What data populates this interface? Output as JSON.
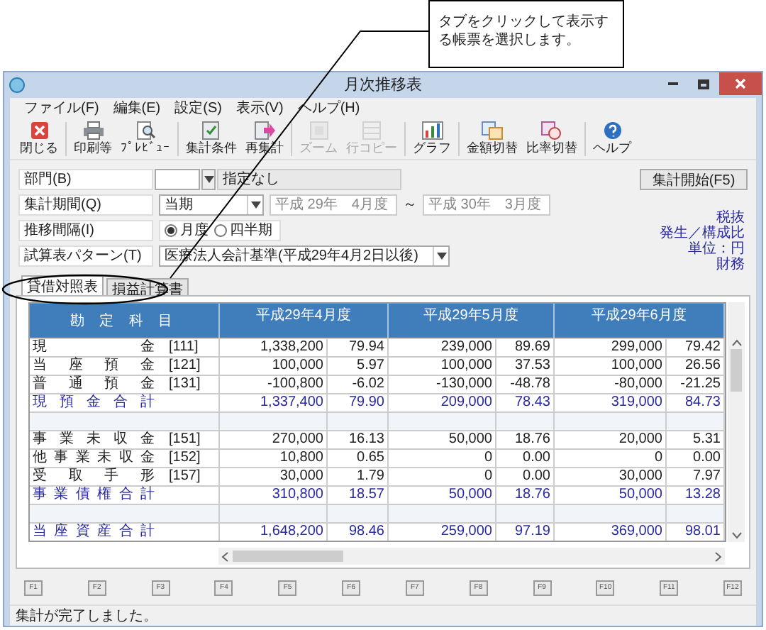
{
  "callout": {
    "text": "タブをクリックして表示する帳票を選択します。"
  },
  "window": {
    "title": "月次推移表"
  },
  "menu": [
    "ファイル(F)",
    "編集(E)",
    "設定(S)",
    "表示(V)",
    "ヘルプ(H)"
  ],
  "toolbar": [
    {
      "label": "閉じる",
      "kind": "close",
      "disabled": false,
      "separator_after": true
    },
    {
      "label": "印刷等",
      "kind": "print",
      "disabled": false,
      "separator_after": false
    },
    {
      "label": "ﾌﾟﾚﾋﾞｭｰ",
      "kind": "preview",
      "disabled": false,
      "separator_after": true
    },
    {
      "label": "集計条件",
      "kind": "conditions",
      "disabled": false,
      "separator_after": false
    },
    {
      "label": "再集計",
      "kind": "recalc",
      "disabled": false,
      "separator_after": true
    },
    {
      "label": "ズーム",
      "kind": "zoom",
      "disabled": true,
      "separator_after": false
    },
    {
      "label": "行コピー",
      "kind": "copy",
      "disabled": true,
      "separator_after": true
    },
    {
      "label": "グラフ",
      "kind": "graph",
      "disabled": false,
      "separator_after": true
    },
    {
      "label": "金額切替",
      "kind": "amount",
      "disabled": false,
      "separator_after": false
    },
    {
      "label": "比率切替",
      "kind": "ratio",
      "disabled": false,
      "separator_after": true
    },
    {
      "label": "ヘルプ",
      "kind": "help",
      "disabled": false,
      "separator_after": false
    }
  ],
  "form": {
    "department": {
      "label": "部門(B)",
      "value": "指定なし"
    },
    "period": {
      "label": "集計期間(Q)",
      "value": "当期",
      "from": "平成 29年　4月度",
      "separator": "～",
      "to": "平成 30年　3月度"
    },
    "interval": {
      "label": "推移間隔(I)",
      "options": [
        {
          "label": "月度",
          "selected": true
        },
        {
          "label": "四半期",
          "selected": false
        }
      ]
    },
    "pattern": {
      "label": "試算表パターン(T)",
      "value": "医療法人会計基準(平成29年4月2日以後)"
    },
    "start_button": "集計開始(F5)"
  },
  "info": [
    "税抜",
    "発生／構成比",
    "単位：円",
    "財務"
  ],
  "tabs": [
    {
      "label": "貸借対照表",
      "selected": true
    },
    {
      "label": "損益計算書",
      "selected": false
    }
  ],
  "table": {
    "account_header": "勘 定 科 目",
    "months": [
      "平成29年4月度",
      "平成29年5月度",
      "平成29年6月度"
    ],
    "rows": [
      {
        "kind": "account",
        "name": "現 金",
        "code": "[111]",
        "cells": [
          "1,338,200",
          "79.94",
          "239,000",
          "89.69",
          "299,000",
          "79.42"
        ]
      },
      {
        "kind": "account",
        "name": "当 座 預 金",
        "code": "[121]",
        "cells": [
          "100,000",
          "5.97",
          "100,000",
          "37.53",
          "100,000",
          "26.56"
        ]
      },
      {
        "kind": "account",
        "name": "普 通 預 金",
        "code": "[131]",
        "cells": [
          "-100,800",
          "-6.02",
          "-130,000",
          "-48.78",
          "-80,000",
          "-21.25"
        ]
      },
      {
        "kind": "total",
        "name": "現 預 金 合 計",
        "cells": [
          "1,337,400",
          "79.90",
          "209,000",
          "78.43",
          "319,000",
          "84.73"
        ]
      },
      {
        "kind": "blank"
      },
      {
        "kind": "account",
        "name": "事 業 未 収 金",
        "code": "[151]",
        "cells": [
          "270,000",
          "16.13",
          "50,000",
          "18.76",
          "20,000",
          "5.31"
        ]
      },
      {
        "kind": "account",
        "name": "他 事 業 未 収 金",
        "code": "[152]",
        "cells": [
          "10,800",
          "0.65",
          "0",
          "0.00",
          "0",
          "0.00"
        ]
      },
      {
        "kind": "account",
        "name": "受 取 手 形",
        "code": "[157]",
        "cells": [
          "30,000",
          "1.79",
          "0",
          "0.00",
          "30,000",
          "7.97"
        ]
      },
      {
        "kind": "total",
        "name": "事 業 債 権 合 計",
        "cells": [
          "310,800",
          "18.57",
          "50,000",
          "18.76",
          "50,000",
          "13.28"
        ]
      },
      {
        "kind": "blank"
      },
      {
        "kind": "total",
        "name": "当 座 資 産 合 計",
        "cells": [
          "1,648,200",
          "98.46",
          "259,000",
          "97.19",
          "369,000",
          "98.01"
        ]
      }
    ]
  },
  "function_keys": [
    "F1",
    "F2",
    "F3",
    "F4",
    "F5",
    "F6",
    "F7",
    "F8",
    "F9",
    "F10",
    "F11",
    "F12"
  ],
  "status_bar": "集計が完了しました。"
}
